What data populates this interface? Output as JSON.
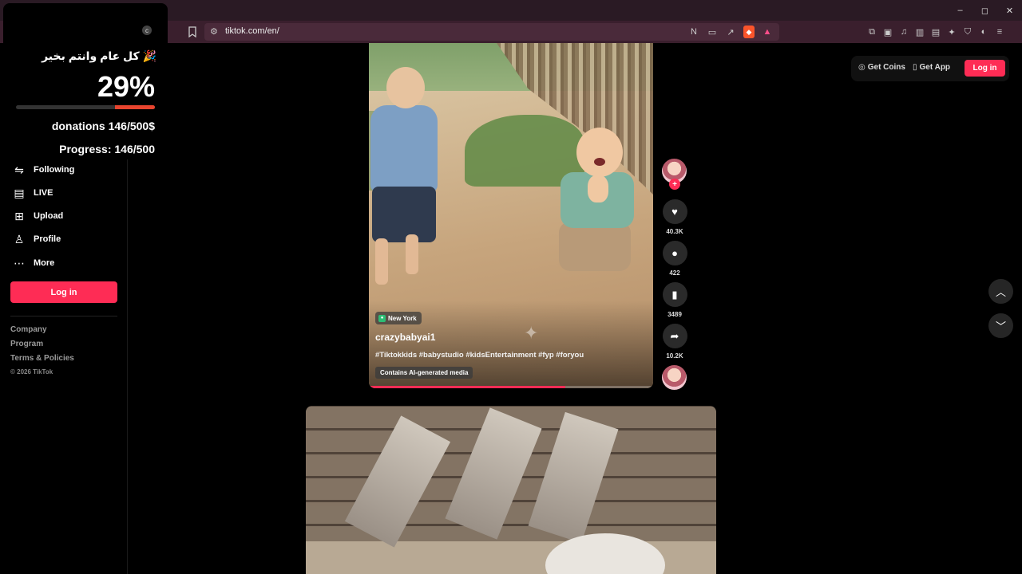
{
  "browser": {
    "url": "tiktok.com/en/",
    "window_controls": [
      "–",
      "◻",
      "✕"
    ]
  },
  "overlay": {
    "greeting": "🎉 كل عام وانتم بخير",
    "percent_label": "29%",
    "progress_fraction": 0.29,
    "donations": "donations 146/500$",
    "progress": "Progress: 146/500"
  },
  "sidebar": {
    "items": [
      {
        "label": "Following",
        "icon": "following-icon"
      },
      {
        "label": "LIVE",
        "icon": "live-icon"
      },
      {
        "label": "Upload",
        "icon": "upload-icon"
      },
      {
        "label": "Profile",
        "icon": "profile-icon"
      },
      {
        "label": "More",
        "icon": "more-icon"
      }
    ],
    "login": "Log in",
    "footer": [
      "Company",
      "Program",
      "Terms & Policies"
    ],
    "copyright": "© 2026 TikTok"
  },
  "header": {
    "get_coins": "Get Coins",
    "get_app": "Get App",
    "login": "Log in"
  },
  "video": {
    "location": "New York",
    "username": "crazybabyai1",
    "hashtags": "#Tiktokkids #babystudio #kidsEntertainment #fyp #foryou",
    "ai_label": "Contains AI-generated media",
    "progress_fraction": 0.69,
    "likes": "40.3K",
    "comments": "422",
    "saves": "3489",
    "shares": "10.2K"
  },
  "colors": {
    "accent": "#fe2c55",
    "overlay_bar": "#e8442e"
  }
}
